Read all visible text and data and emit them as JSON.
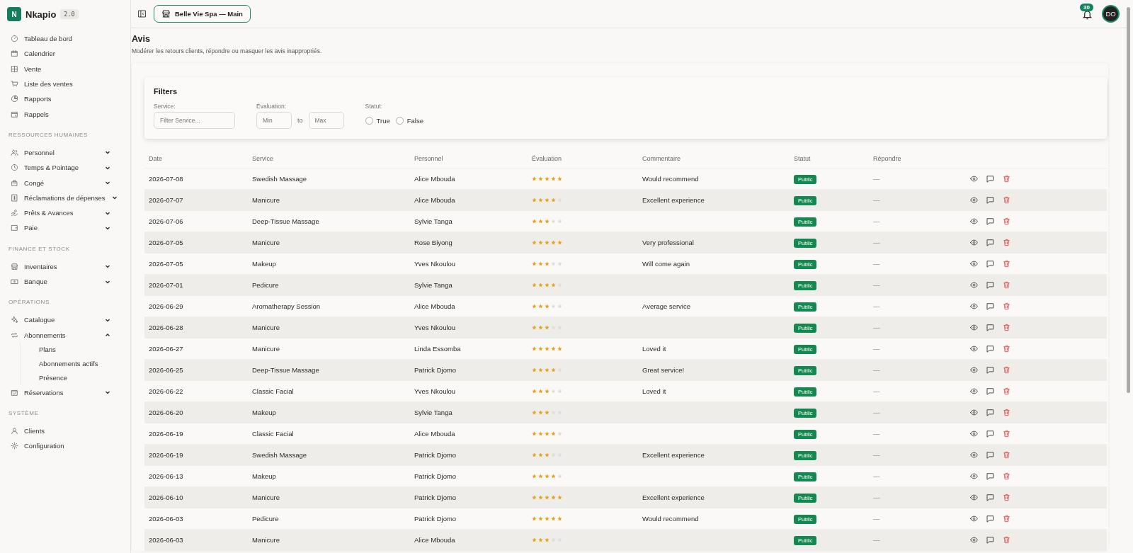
{
  "brand": {
    "logo": "N",
    "name": "Nkapio",
    "version": "2.0"
  },
  "sidebar": {
    "sections": [
      {
        "items": [
          {
            "label": "Tableau de bord"
          },
          {
            "label": "Calendrier"
          },
          {
            "label": "Vente"
          },
          {
            "label": "Liste des ventes"
          },
          {
            "label": "Rapports"
          },
          {
            "label": "Rappels"
          }
        ]
      },
      {
        "title": "RESSOURCES HUMAINES",
        "items": [
          {
            "label": "Personnel",
            "expanded": false
          },
          {
            "label": "Temps & Pointage",
            "expanded": false
          },
          {
            "label": "Congé",
            "expanded": false
          },
          {
            "label": "Réclamations de dépenses",
            "expanded": false
          },
          {
            "label": "Prêts & Avances",
            "expanded": false
          },
          {
            "label": "Paie",
            "expanded": false
          }
        ]
      },
      {
        "title": "FINANCE ET STOCK",
        "items": [
          {
            "label": "Inventaires",
            "expanded": false
          },
          {
            "label": "Banque",
            "expanded": false
          }
        ]
      },
      {
        "title": "OPÉRATIONS",
        "items": [
          {
            "label": "Catalogue",
            "expanded": false
          },
          {
            "label": "Abonnements",
            "expanded": true,
            "children": [
              {
                "label": "Plans"
              },
              {
                "label": "Abonnements actifs"
              },
              {
                "label": "Présence"
              }
            ]
          },
          {
            "label": "Réservations",
            "expanded": false
          }
        ]
      },
      {
        "title": "SYSTÈME",
        "items": [
          {
            "label": "Clients"
          },
          {
            "label": "Configuration"
          }
        ]
      }
    ]
  },
  "topbar": {
    "store": "Belle Vie Spa — Main",
    "notifications": "30",
    "avatar": "DO"
  },
  "page": {
    "title": "Avis",
    "subtitle": "Modérer les retours clients, répondre ou masquer les avis inappropriés."
  },
  "filters": {
    "title": "Filters",
    "service_label": "Service:",
    "service_placeholder": "Filter Service...",
    "rating_label": "Évaluation:",
    "min_placeholder": "Min",
    "to": "to",
    "max_placeholder": "Max",
    "status_label": "Statut:",
    "options": [
      {
        "label": "True",
        "selected": false
      },
      {
        "label": "False",
        "selected": false
      }
    ]
  },
  "table": {
    "columns": [
      "Date",
      "Service",
      "Personnel",
      "Évaluation",
      "Commentaire",
      "Statut",
      "Répondre"
    ],
    "rows": [
      {
        "date": "2026-07-08",
        "service": "Swedish Massage",
        "staff": "Alice Mbouda",
        "stars": 5,
        "comment": "Would recommend",
        "status": "Public",
        "reply": "—"
      },
      {
        "date": "2026-07-07",
        "service": "Manicure",
        "staff": "Alice Mbouda",
        "stars": 4,
        "comment": "Excellent experience",
        "status": "Public",
        "reply": "—"
      },
      {
        "date": "2026-07-06",
        "service": "Deep-Tissue Massage",
        "staff": "Sylvie Tanga",
        "stars": 3,
        "status": "Public",
        "reply": "—"
      },
      {
        "date": "2026-07-05",
        "service": "Manicure",
        "staff": "Rose Biyong",
        "stars": 5,
        "comment": "Very professional",
        "status": "Public",
        "reply": "—"
      },
      {
        "date": "2026-07-05",
        "service": "Makeup",
        "staff": "Yves Nkoulou",
        "stars": 3,
        "comment": "Will come again",
        "status": "Public",
        "reply": "—"
      },
      {
        "date": "2026-07-01",
        "service": "Pedicure",
        "staff": "Sylvie Tanga",
        "stars": 4,
        "status": "Public",
        "reply": "—"
      },
      {
        "date": "2026-06-29",
        "service": "Aromatherapy Session",
        "staff": "Alice Mbouda",
        "stars": 3,
        "comment": "Average service",
        "status": "Public",
        "reply": "—"
      },
      {
        "date": "2026-06-28",
        "service": "Manicure",
        "staff": "Yves Nkoulou",
        "stars": 3,
        "status": "Public",
        "reply": "—"
      },
      {
        "date": "2026-06-27",
        "service": "Manicure",
        "staff": "Linda Essomba",
        "stars": 5,
        "comment": "Loved it",
        "status": "Public",
        "reply": "—"
      },
      {
        "date": "2026-06-25",
        "service": "Deep-Tissue Massage",
        "staff": "Patrick Djomo",
        "stars": 4,
        "comment": "Great service!",
        "status": "Public",
        "reply": "—"
      },
      {
        "date": "2026-06-22",
        "service": "Classic Facial",
        "staff": "Yves Nkoulou",
        "stars": 3,
        "comment": "Loved it",
        "status": "Public",
        "reply": "—"
      },
      {
        "date": "2026-06-20",
        "service": "Makeup",
        "staff": "Sylvie Tanga",
        "stars": 3,
        "status": "Public",
        "reply": "—"
      },
      {
        "date": "2026-06-19",
        "service": "Classic Facial",
        "staff": "Alice Mbouda",
        "stars": 4,
        "status": "Public",
        "reply": "—"
      },
      {
        "date": "2026-06-19",
        "service": "Swedish Massage",
        "staff": "Patrick Djomo",
        "stars": 3,
        "comment": "Excellent experience",
        "status": "Public",
        "reply": "—"
      },
      {
        "date": "2026-06-13",
        "service": "Makeup",
        "staff": "Patrick Djomo",
        "stars": 4,
        "status": "Public",
        "reply": "—"
      },
      {
        "date": "2026-06-10",
        "service": "Manicure",
        "staff": "Patrick Djomo",
        "stars": 5,
        "comment": "Excellent experience",
        "status": "Public",
        "reply": "—"
      },
      {
        "date": "2026-06-03",
        "service": "Pedicure",
        "staff": "Patrick Djomo",
        "stars": 5,
        "comment": "Would recommend",
        "status": "Public",
        "reply": "—"
      },
      {
        "date": "2026-06-03",
        "service": "Manicure",
        "staff": "Alice Mbouda",
        "stars": 3,
        "status": "Public",
        "reply": "—"
      }
    ]
  }
}
